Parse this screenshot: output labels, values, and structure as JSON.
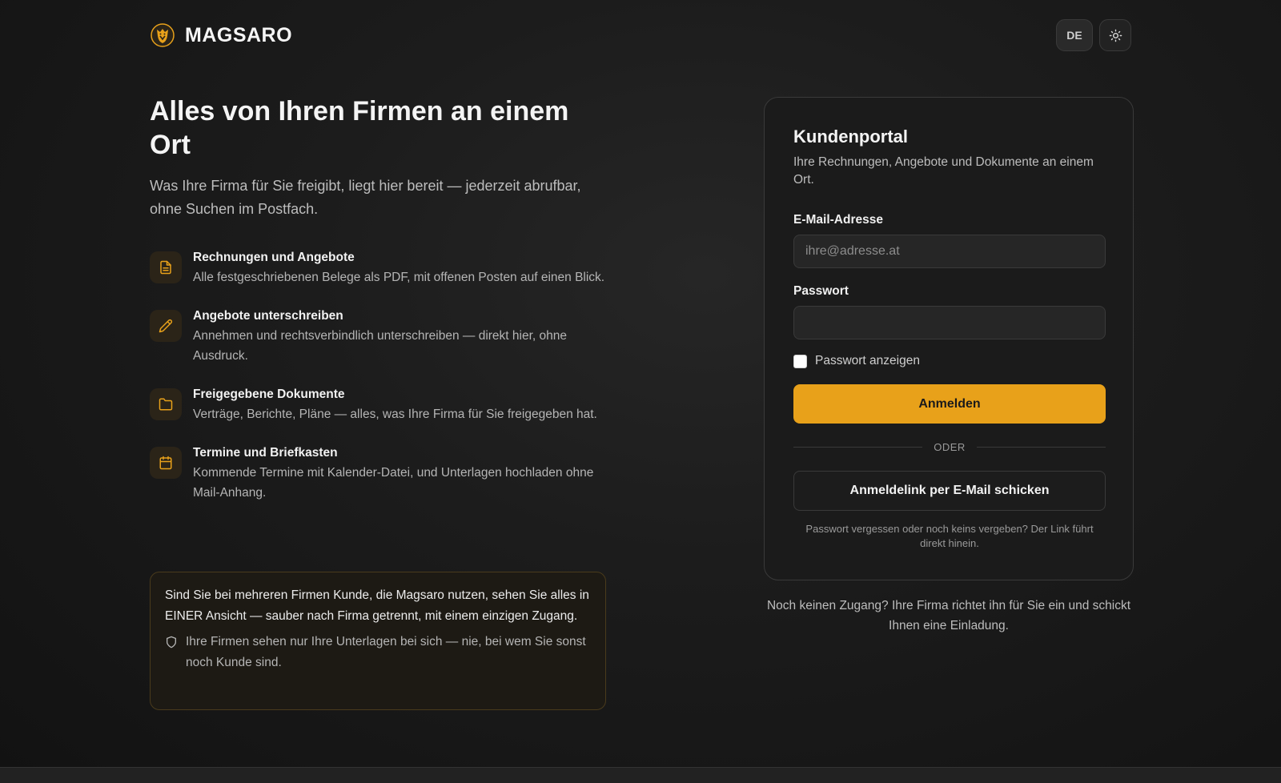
{
  "header": {
    "brand_name": "MAGSARO",
    "lang_button": "DE",
    "theme_icon": "sun-icon"
  },
  "intro": {
    "headline": "Alles von Ihren Firmen an einem Ort",
    "subhead": "Was Ihre Firma für Sie freigibt, liegt hier bereit — jederzeit abrufbar, ohne Suchen im Postfach."
  },
  "features": [
    {
      "icon": "document-icon",
      "title": "Rechnungen und Angebote",
      "desc": "Alle festgeschriebenen Belege als PDF, mit offenen Posten auf einen Blick."
    },
    {
      "icon": "pencil-icon",
      "title": "Angebote unterschreiben",
      "desc": "Annehmen und rechtsverbindlich unterschreiben — direkt hier, ohne Ausdruck."
    },
    {
      "icon": "folder-icon",
      "title": "Freigegebene Dokumente",
      "desc": "Verträge, Berichte, Pläne — alles, was Ihre Firma für Sie freigegeben hat."
    },
    {
      "icon": "calendar-icon",
      "title": "Termine und Briefkasten",
      "desc": "Kommende Termine mit Kalender-Datei, und Unterlagen hochladen ohne Mail-Anhang."
    }
  ],
  "infobox": {
    "text": "Sind Sie bei mehreren Firmen Kunde, die Magsaro nutzen, sehen Sie alles in EINER Ansicht — sauber nach Firma getrennt, mit einem einzigen Zugang.",
    "note": "Ihre Firmen sehen nur Ihre Unterlagen bei sich — nie, bei wem Sie sonst noch Kunde sind."
  },
  "login": {
    "title": "Kundenportal",
    "subtitle": "Ihre Rechnungen, Angebote und Dokumente an einem Ort.",
    "email_label": "E-Mail-Adresse",
    "email_placeholder": "ihre@adresse.at",
    "email_value": "",
    "password_label": "Passwort",
    "password_value": "",
    "show_password_label": "Passwort anzeigen",
    "show_password_checked": false,
    "submit_label": "Anmelden",
    "divider_text": "ODER",
    "magic_link_label": "Anmeldelink per E-Mail schicken",
    "hint": "Passwort vergessen oder noch keins vergeben? Der Link führt direkt hinein."
  },
  "below_card": "Noch keinen Zugang? Ihre Firma richtet ihn für Sie ein und schickt Ihnen eine Einladung.",
  "colors": {
    "accent": "#e8a11a",
    "background": "#1a1a1a",
    "card": "#1b1b1b"
  }
}
